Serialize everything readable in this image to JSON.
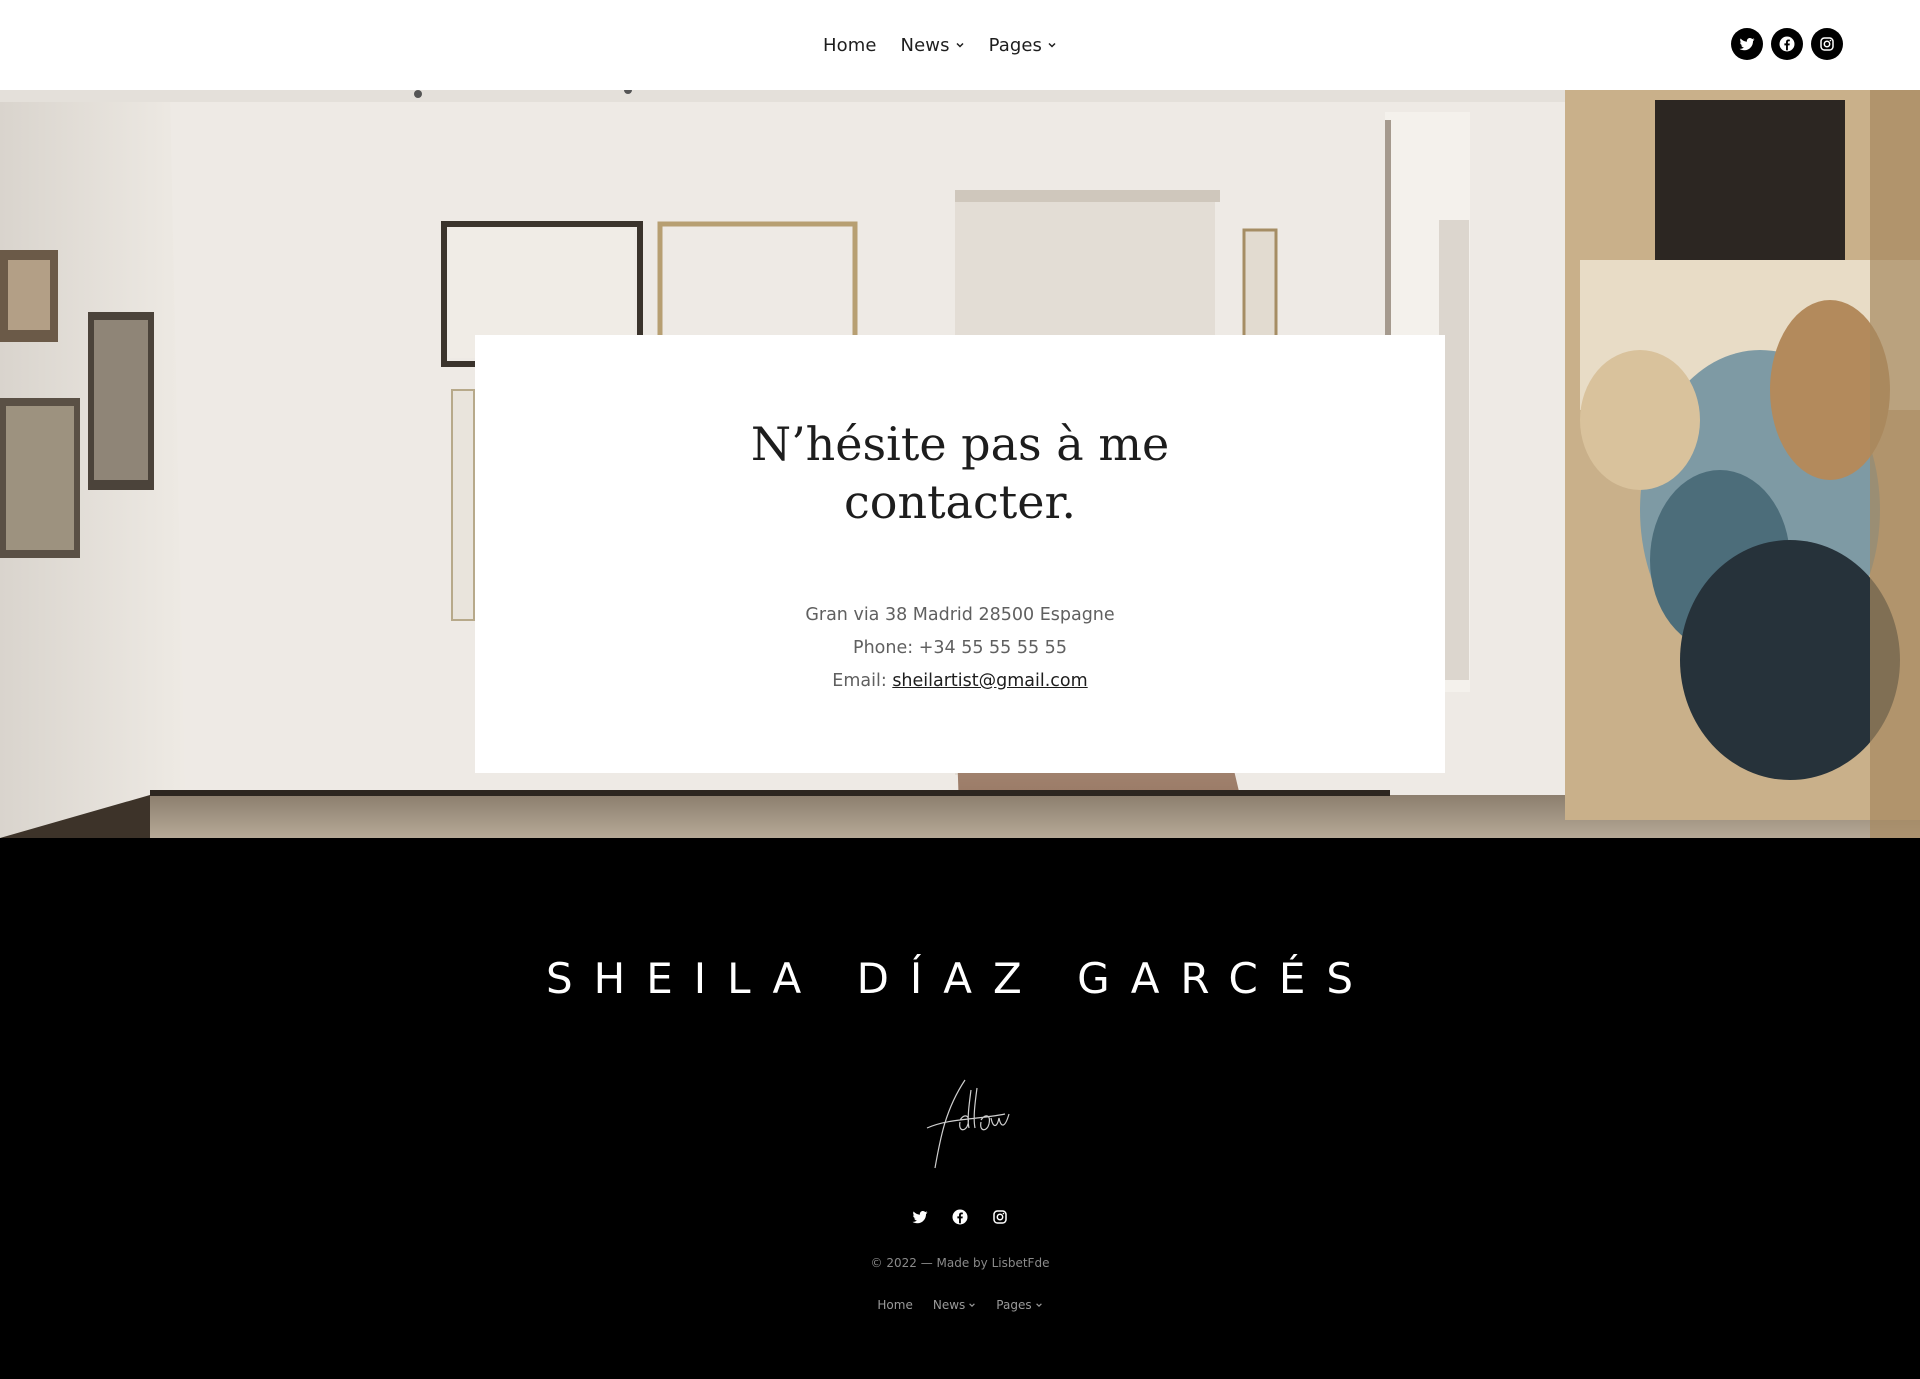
{
  "header": {
    "nav": [
      {
        "label": "Home"
      },
      {
        "label": "News",
        "has_dropdown": true
      },
      {
        "label": "Pages",
        "has_dropdown": true
      }
    ],
    "social": [
      "twitter-icon",
      "facebook-icon",
      "instagram-icon"
    ]
  },
  "contact": {
    "title": "N’hésite pas à me contacter.",
    "address": "Gran via 38 Madrid 28500 Espagne",
    "phone": "Phone: +34 55 55 55 55",
    "email_label": "Email: ",
    "email": "sheilartist@gmail.com"
  },
  "footer": {
    "brand": "SHEILA DÍAZ GARCÉS",
    "follow_signature": "follow",
    "social": [
      "twitter-icon",
      "facebook-icon",
      "instagram-icon"
    ],
    "copyright": "© 2022 — Made by LisbetFde",
    "nav": [
      {
        "label": "Home"
      },
      {
        "label": "News",
        "has_dropdown": true
      },
      {
        "label": "Pages",
        "has_dropdown": true
      }
    ]
  },
  "colors": {
    "header_bg": "#ffffff",
    "footer_bg": "#000000",
    "card_bg": "#ffffff",
    "text_dark": "#1d1d1d",
    "text_muted": "#606060"
  }
}
